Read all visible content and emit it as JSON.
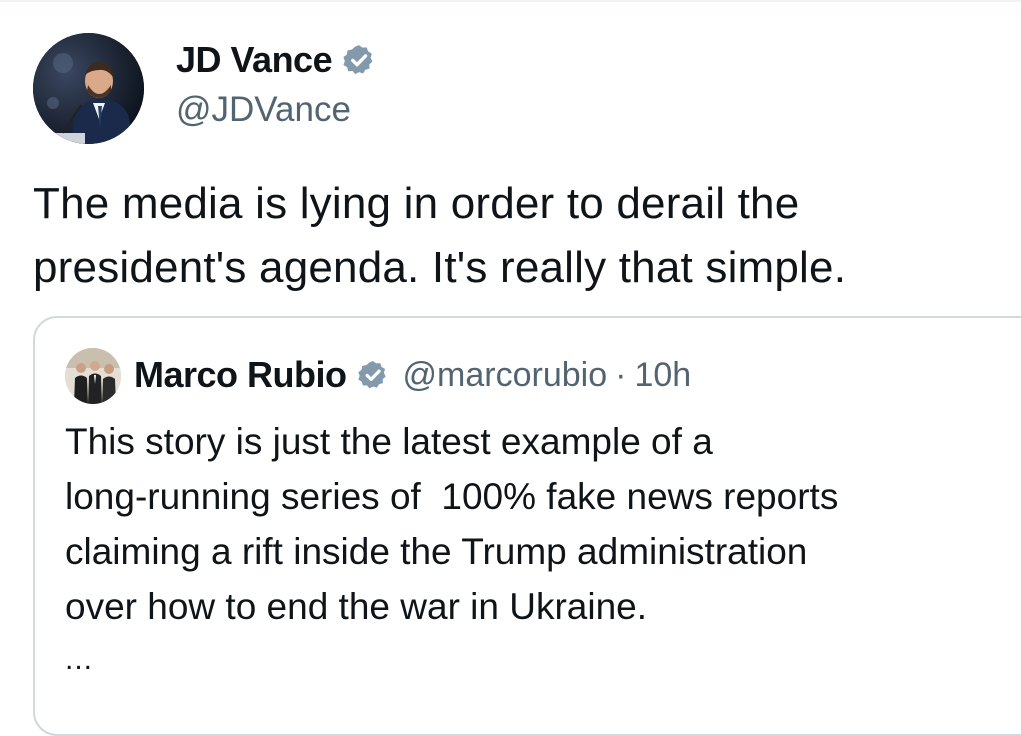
{
  "tweet": {
    "author_name": "JD Vance",
    "author_handle": "@JDVance",
    "verified_icon": "verified-badge-icon",
    "text": "The media is lying in order to derail the president's agenda. It's really that simple."
  },
  "quoted_tweet": {
    "author_name": "Marco Rubio",
    "author_handle": "@marcorubio",
    "separator": "·",
    "timestamp": "10h",
    "verified_icon": "verified-badge-icon",
    "text": "This story is just the latest example of a\nlong-running series of  100% fake news reports\nclaiming a rift inside the Trump administration\nover how to end the war in Ukraine.",
    "ellipsis": "..."
  },
  "colors": {
    "text_primary": "#0f1419",
    "text_secondary": "#536471",
    "border": "#cfd9de",
    "verified_badge": "#829aab"
  }
}
